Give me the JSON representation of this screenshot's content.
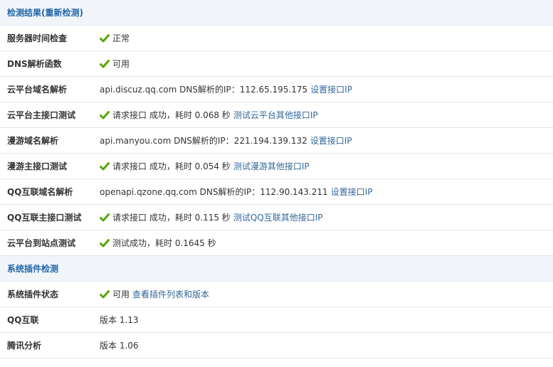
{
  "colors": {
    "header_bg": "#f1f5fa",
    "header_text": "#2366a8",
    "check": "#57a700",
    "link": "#336699"
  },
  "sections": [
    {
      "title": "检测结果(重新检测)",
      "rows": [
        {
          "label": "服务器时间检查",
          "check": true,
          "text": "正常",
          "link": ""
        },
        {
          "label": "DNS解析函数",
          "check": true,
          "text": "可用",
          "link": ""
        },
        {
          "label": "云平台域名解析",
          "check": false,
          "text": "api.discuz.qq.com DNS解析的IP：112.65.195.175",
          "link": "设置接口IP"
        },
        {
          "label": "云平台主接口测试",
          "check": true,
          "text": "请求接口 成功，耗时 0.068 秒",
          "link": "测试云平台其他接口IP"
        },
        {
          "label": "漫游域名解析",
          "check": false,
          "text": "api.manyou.com DNS解析的IP：221.194.139.132",
          "link": "设置接口IP"
        },
        {
          "label": "漫游主接口测试",
          "check": true,
          "text": "请求接口 成功，耗时 0.054 秒",
          "link": "测试漫游其他接口IP"
        },
        {
          "label": "QQ互联域名解析",
          "check": false,
          "text": "openapi.qzone.qq.com DNS解析的IP：112.90.143.211",
          "link": "设置接口IP"
        },
        {
          "label": "QQ互联主接口测试",
          "check": true,
          "text": "请求接口 成功，耗时 0.115 秒",
          "link": "测试QQ互联其他接口IP"
        },
        {
          "label": "云平台到站点测试",
          "check": true,
          "text": "测试成功，耗时 0.1645 秒",
          "link": ""
        }
      ]
    },
    {
      "title": "系统插件检测",
      "rows": [
        {
          "label": "系统插件状态",
          "check": true,
          "text": "可用",
          "link": "查看插件列表和版本"
        },
        {
          "label": "QQ互联",
          "check": false,
          "text": "版本 1.13",
          "link": ""
        },
        {
          "label": "腾讯分析",
          "check": false,
          "text": "版本 1.06",
          "link": ""
        }
      ]
    }
  ]
}
